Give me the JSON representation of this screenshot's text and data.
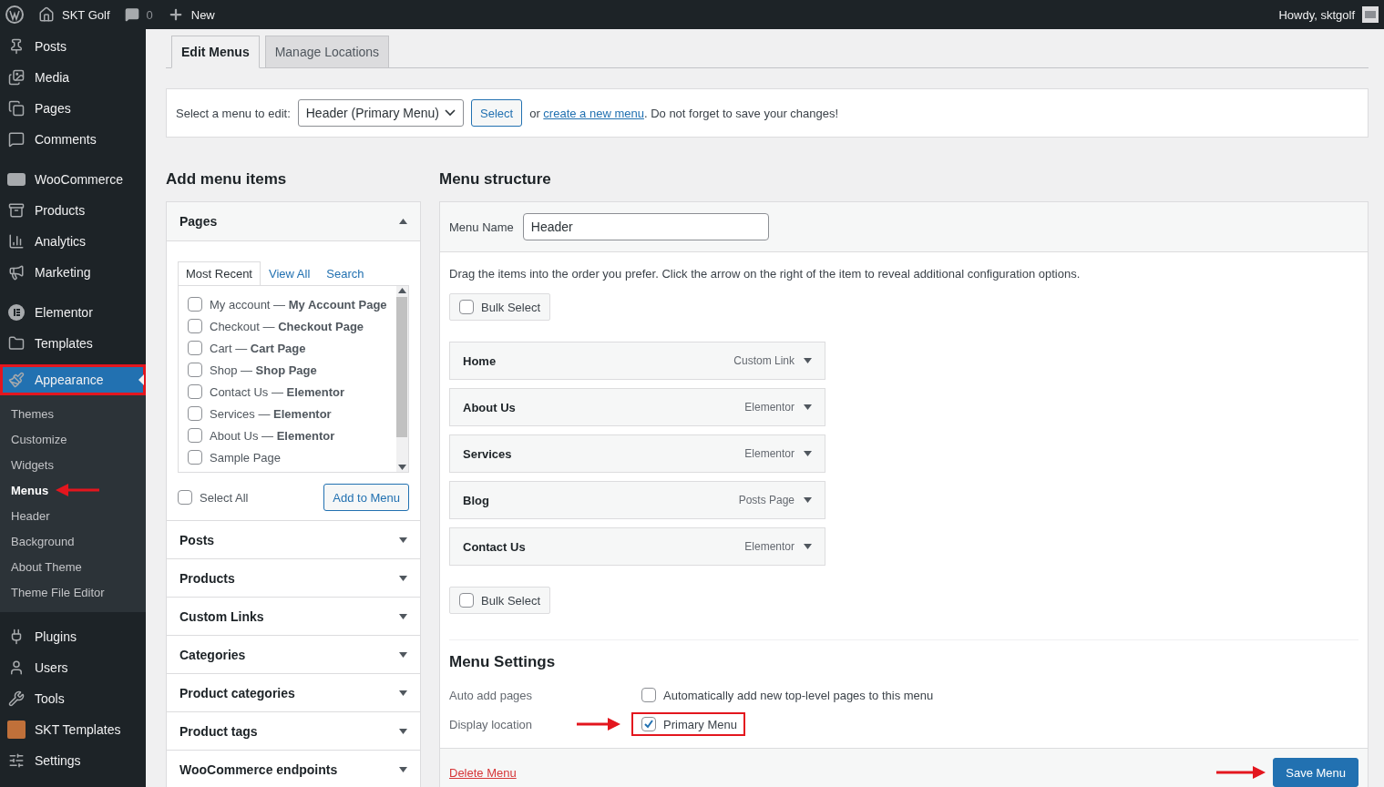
{
  "admin_bar": {
    "site_name": "SKT Golf",
    "comments_count": "0",
    "new_label": "New",
    "greeting": "Howdy, sktgolf"
  },
  "sidebar": {
    "sections": [
      [
        {
          "label": "Posts",
          "selected": false
        },
        {
          "label": "Media",
          "selected": false
        },
        {
          "label": "Pages",
          "selected": false
        },
        {
          "label": "Comments",
          "selected": false
        }
      ],
      [
        {
          "label": "WooCommerce",
          "selected": false
        },
        {
          "label": "Products",
          "selected": false
        },
        {
          "label": "Analytics",
          "selected": false
        },
        {
          "label": "Marketing",
          "selected": false
        }
      ],
      [
        {
          "label": "Elementor",
          "selected": false
        },
        {
          "label": "Templates",
          "selected": false
        },
        {
          "label": "Appearance",
          "selected": true,
          "annotated": true,
          "children": [
            {
              "label": "Themes",
              "selected": false,
              "arrow": false
            },
            {
              "label": "Customize",
              "selected": false,
              "arrow": false
            },
            {
              "label": "Widgets",
              "selected": false,
              "arrow": false
            },
            {
              "label": "Menus",
              "selected": true,
              "arrow": true
            },
            {
              "label": "Header",
              "selected": false,
              "arrow": false
            },
            {
              "label": "Background",
              "selected": false,
              "arrow": false
            },
            {
              "label": "About Theme",
              "selected": false,
              "arrow": false
            },
            {
              "label": "Theme File Editor",
              "selected": false,
              "arrow": false
            }
          ]
        }
      ],
      [
        {
          "label": "Plugins",
          "selected": false
        },
        {
          "label": "Users",
          "selected": false
        },
        {
          "label": "Tools",
          "selected": false
        },
        {
          "label": "SKT Templates",
          "selected": false
        },
        {
          "label": "Settings",
          "selected": false
        }
      ]
    ]
  },
  "tabs": [
    {
      "label": "Edit Menus",
      "selected": true
    },
    {
      "label": "Manage Locations",
      "selected": false
    }
  ],
  "menu_select": {
    "label": "Select a menu to edit:",
    "value": "Header (Primary Menu)",
    "button": "Select",
    "text_before_link": "or",
    "link": "create a new menu",
    "text_after_link": ". Do not forget to save your changes!"
  },
  "add_items": {
    "heading": "Add menu items",
    "sections": [
      {
        "title": "Pages",
        "expanded": true,
        "tabs": [
          {
            "label": "Most Recent",
            "selected": true
          },
          {
            "label": "View All",
            "selected": false
          },
          {
            "label": "Search",
            "selected": false
          }
        ],
        "items": [
          {
            "label": "My account — **My Account Page**",
            "checked": false
          },
          {
            "label": "Checkout — **Checkout Page**",
            "checked": false
          },
          {
            "label": "Cart — **Cart Page**",
            "checked": false
          },
          {
            "label": "Shop — **Shop Page**",
            "checked": false
          },
          {
            "label": "Contact Us — **Elementor**",
            "checked": false
          },
          {
            "label": "Services — **Elementor**",
            "checked": false
          },
          {
            "label": "About Us — **Elementor**",
            "checked": false
          },
          {
            "label": "Sample Page",
            "checked": false
          }
        ],
        "select_all": {
          "label": "Select All",
          "checked": false
        },
        "button": "Add to Menu"
      },
      {
        "title": "Posts",
        "expanded": false
      },
      {
        "title": "Products",
        "expanded": false
      },
      {
        "title": "Custom Links",
        "expanded": false
      },
      {
        "title": "Categories",
        "expanded": false
      },
      {
        "title": "Product categories",
        "expanded": false
      },
      {
        "title": "Product tags",
        "expanded": false
      },
      {
        "title": "WooCommerce endpoints",
        "expanded": false
      }
    ]
  },
  "menu_structure": {
    "heading": "Menu structure",
    "name_label": "Menu Name",
    "name_value": "Header",
    "instructions": "Drag the items into the order you prefer. Click the arrow on the right of the item to reveal additional configuration options.",
    "bulk_select_top": {
      "label": "Bulk Select",
      "checked": false
    },
    "items": [
      {
        "title": "Home",
        "type": "Custom Link"
      },
      {
        "title": "About Us",
        "type": "Elementor"
      },
      {
        "title": "Services",
        "type": "Elementor"
      },
      {
        "title": "Blog",
        "type": "Posts Page"
      },
      {
        "title": "Contact Us",
        "type": "Elementor"
      }
    ],
    "bulk_select_bottom": {
      "label": "Bulk Select",
      "checked": false
    },
    "settings": {
      "heading": "Menu Settings",
      "rows": [
        {
          "label": "Auto add pages",
          "option": "Automatically add new top-level pages to this menu",
          "checked": false,
          "annotated": false,
          "arrow": false
        },
        {
          "label": "Display location",
          "option": "Primary Menu",
          "checked": true,
          "annotated": true,
          "arrow": true
        }
      ]
    },
    "delete_link": "Delete Menu",
    "save_button": {
      "label": "Save Menu",
      "arrow": true
    }
  }
}
